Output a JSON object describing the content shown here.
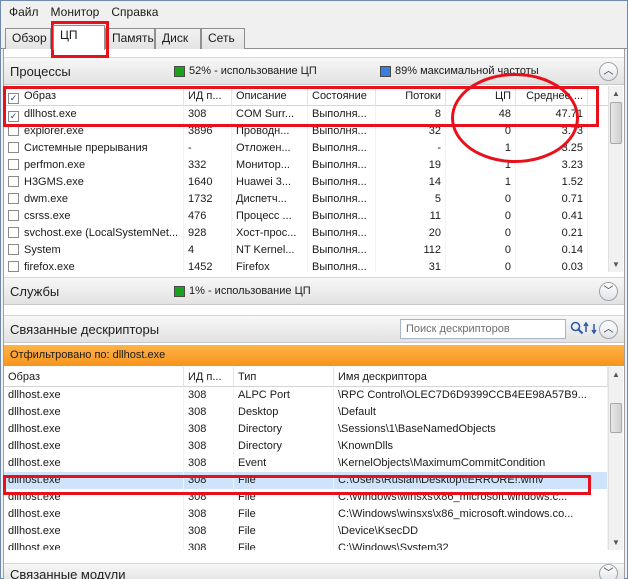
{
  "menu": [
    "Файл",
    "Монитор",
    "Справка"
  ],
  "tabs": [
    "Обзор",
    "ЦП",
    "Память",
    "Диск",
    "Сеть"
  ],
  "processes": {
    "title": "Процессы",
    "cpu_usage": "52% - использование ЦП",
    "max_freq": "89% максимальной частоты",
    "columns": [
      "Образ",
      "ИД п...",
      "Описание",
      "Состояние",
      "Потоки",
      "ЦП",
      "Среднее ..."
    ],
    "rows": [
      {
        "checked": true,
        "image": "dllhost.exe",
        "pid": "308",
        "desc": "COM Surr...",
        "state": "Выполня...",
        "threads": "8",
        "cpu": "48",
        "avg": "47.71"
      },
      {
        "checked": false,
        "image": "explorer.exe",
        "pid": "3896",
        "desc": "Проводн...",
        "state": "Выполня...",
        "threads": "32",
        "cpu": "0",
        "avg": "3.73"
      },
      {
        "checked": false,
        "image": "Системные прерывания",
        "pid": "-",
        "desc": "Отложен...",
        "state": "Выполня...",
        "threads": "-",
        "cpu": "1",
        "avg": "3.25"
      },
      {
        "checked": false,
        "image": "perfmon.exe",
        "pid": "332",
        "desc": "Монитор...",
        "state": "Выполня...",
        "threads": "19",
        "cpu": "1",
        "avg": "3.23"
      },
      {
        "checked": false,
        "image": "H3GMS.exe",
        "pid": "1640",
        "desc": "Huawei 3...",
        "state": "Выполня...",
        "threads": "14",
        "cpu": "1",
        "avg": "1.52"
      },
      {
        "checked": false,
        "image": "dwm.exe",
        "pid": "1732",
        "desc": "Диспетч...",
        "state": "Выполня...",
        "threads": "5",
        "cpu": "0",
        "avg": "0.71"
      },
      {
        "checked": false,
        "image": "csrss.exe",
        "pid": "476",
        "desc": "Процесс ...",
        "state": "Выполня...",
        "threads": "11",
        "cpu": "0",
        "avg": "0.41"
      },
      {
        "checked": false,
        "image": "svchost.exe (LocalSystemNet...",
        "pid": "928",
        "desc": "Хост-прос...",
        "state": "Выполня...",
        "threads": "20",
        "cpu": "0",
        "avg": "0.21"
      },
      {
        "checked": false,
        "image": "System",
        "pid": "4",
        "desc": "NT Kernel...",
        "state": "Выполня...",
        "threads": "112",
        "cpu": "0",
        "avg": "0.14"
      },
      {
        "checked": false,
        "image": "firefox.exe",
        "pid": "1452",
        "desc": "Firefox",
        "state": "Выполня...",
        "threads": "31",
        "cpu": "0",
        "avg": "0.03"
      }
    ]
  },
  "services": {
    "title": "Службы",
    "cpu_usage": "1% - использование ЦП"
  },
  "handles": {
    "title": "Связанные дескрипторы",
    "search_placeholder": "Поиск дескрипторов",
    "filter": "Отфильтровано по: dllhost.exe",
    "columns": [
      "Образ",
      "ИД п...",
      "Тип",
      "Имя дескриптора"
    ],
    "rows": [
      {
        "image": "dllhost.exe",
        "pid": "308",
        "type": "ALPC Port",
        "name": "\\RPC Control\\OLEC7D6D9399CCB4EE98A57B9..."
      },
      {
        "image": "dllhost.exe",
        "pid": "308",
        "type": "Desktop",
        "name": "\\Default"
      },
      {
        "image": "dllhost.exe",
        "pid": "308",
        "type": "Directory",
        "name": "\\Sessions\\1\\BaseNamedObjects"
      },
      {
        "image": "dllhost.exe",
        "pid": "308",
        "type": "Directory",
        "name": "\\KnownDlls"
      },
      {
        "image": "dllhost.exe",
        "pid": "308",
        "type": "Event",
        "name": "\\KernelObjects\\MaximumCommitCondition"
      },
      {
        "image": "dllhost.exe",
        "pid": "308",
        "type": "File",
        "name": "C:\\Users\\Ruslan\\Desktop\\!ERRORE!.wmv"
      },
      {
        "image": "dllhost.exe",
        "pid": "308",
        "type": "File",
        "name": "C:\\Windows\\winsxs\\x86_microsoft.windows.c..."
      },
      {
        "image": "dllhost.exe",
        "pid": "308",
        "type": "File",
        "name": "C:\\Windows\\winsxs\\x86_microsoft.windows.co..."
      },
      {
        "image": "dllhost.exe",
        "pid": "308",
        "type": "File",
        "name": "\\Device\\KsecDD"
      },
      {
        "image": "dllhost.exe",
        "pid": "308",
        "type": "File",
        "name": "C:\\Windows\\System32"
      }
    ]
  },
  "modules": {
    "title": "Связанные модули"
  },
  "colors": {
    "accent_red": "#e8101a",
    "filter_orange": "#f7941d",
    "cpu_green": "#1aa01a",
    "freq_blue": "#3b7dd8"
  }
}
